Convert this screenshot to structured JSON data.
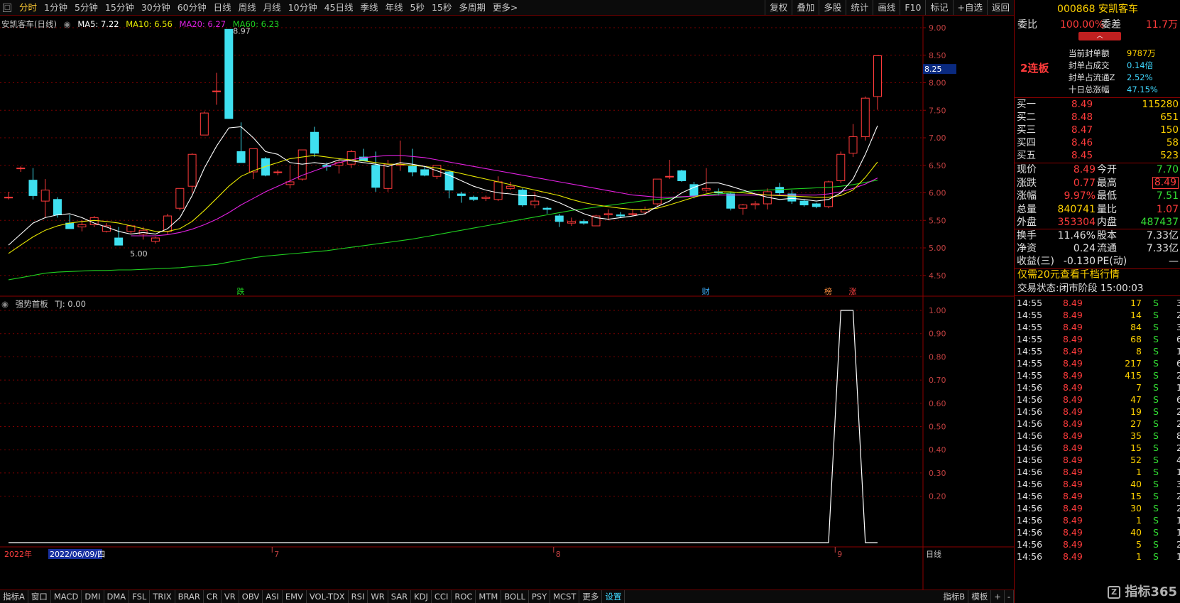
{
  "periods": [
    "分时",
    "1分钟",
    "5分钟",
    "15分钟",
    "30分钟",
    "60分钟",
    "日线",
    "周线",
    "月线",
    "10分钟",
    "45日线",
    "季线",
    "年线",
    "5秒",
    "15秒",
    "多周期",
    "更多>"
  ],
  "tools": [
    "复权",
    "叠加",
    "多股",
    "统计",
    "画线",
    "F10",
    "标记",
    "+自选",
    "返回"
  ],
  "legend": {
    "name": "安凯客车(日线)",
    "ma5": "MA5: 7.22",
    "ma10": "MA10: 6.56",
    "ma20": "MA20: 6.27",
    "ma60": "MA60: 6.23"
  },
  "colors": {
    "up": "#ff3b3b",
    "down": "#3fe0f0",
    "ma5": "#ffffff",
    "ma10": "#e8e800",
    "ma20": "#e020e0",
    "ma60": "#20d020",
    "grid": "#7a0000"
  },
  "price_axis": [
    "9.00",
    "8.50",
    "8.00",
    "7.50",
    "7.00",
    "6.50",
    "6.00",
    "5.50",
    "5.00",
    "4.50"
  ],
  "current_price_label": "8.25",
  "high_label": "8.97",
  "low_label": "5.00",
  "markers": [
    "跌",
    "财",
    "榜",
    "涨"
  ],
  "indicator": {
    "title": "强势首板",
    "value": "TJ: 0.00",
    "axis": [
      "1.00",
      "0.90",
      "0.80",
      "0.70",
      "0.60",
      "0.50",
      "0.40",
      "0.30",
      "0.20"
    ]
  },
  "date_axis": {
    "year": "2022年",
    "cursor": "2022/06/09/四",
    "months": [
      "7",
      "8",
      "9"
    ],
    "cycle": "日线"
  },
  "bottom_tabs": [
    "指标A",
    "窗口",
    "MACD",
    "DMI",
    "DMA",
    "FSL",
    "TRIX",
    "BRAR",
    "CR",
    "VR",
    "OBV",
    "ASI",
    "EMV",
    "VOL-TDX",
    "RSI",
    "WR",
    "SAR",
    "KDJ",
    "CCI",
    "ROC",
    "MTM",
    "BOLL",
    "PSY",
    "MCST",
    "更多",
    "设置"
  ],
  "bottom_right": [
    "指标B",
    "模板",
    "+",
    "-"
  ],
  "stock": {
    "code": "000868",
    "name": "安凯客车"
  },
  "weibi": {
    "label": "委比",
    "value": "100.00%",
    "cha_label": "委差",
    "cha": "11.7万"
  },
  "limit": {
    "boards": "2连板",
    "rows": [
      [
        "当前封单额",
        "9787万"
      ],
      [
        "封单占成交",
        "0.14倍"
      ],
      [
        "封单占流通Z",
        "2.52%"
      ],
      [
        "十日总涨幅",
        "47.15%"
      ]
    ]
  },
  "bids": [
    [
      "买一",
      "8.49",
      "115280"
    ],
    [
      "买二",
      "8.48",
      "651"
    ],
    [
      "买三",
      "8.47",
      "150"
    ],
    [
      "买四",
      "8.46",
      "58"
    ],
    [
      "买五",
      "8.45",
      "523"
    ]
  ],
  "quote": [
    [
      "现价",
      "8.49",
      "今开",
      "7.70"
    ],
    [
      "涨跌",
      "0.77",
      "最高",
      "8.49"
    ],
    [
      "涨幅",
      "9.97%",
      "最低",
      "7.51"
    ],
    [
      "总量",
      "840741",
      "量比",
      "1.07"
    ],
    [
      "外盘",
      "353304",
      "内盘",
      "487437"
    ]
  ],
  "fin": [
    [
      "换手",
      "11.46%",
      "股本",
      "7.33亿"
    ],
    [
      "净资",
      "0.24",
      "流通",
      "7.33亿"
    ],
    [
      "收益(三)",
      "-0.130",
      "PE(动)",
      "—"
    ]
  ],
  "promo": "仅需20元查看千档行情",
  "status": {
    "label": "交易状态:",
    "value": "闭市阶段 15:00:03"
  },
  "ticks": [
    [
      "14:55",
      "8.49",
      "17",
      "S",
      "3"
    ],
    [
      "14:55",
      "8.49",
      "14",
      "S",
      "2"
    ],
    [
      "14:55",
      "8.49",
      "84",
      "S",
      "3"
    ],
    [
      "14:55",
      "8.49",
      "68",
      "S",
      "6"
    ],
    [
      "14:55",
      "8.49",
      "8",
      "S",
      "1"
    ],
    [
      "14:55",
      "8.49",
      "217",
      "S",
      "6"
    ],
    [
      "14:55",
      "8.49",
      "415",
      "S",
      "2"
    ],
    [
      "14:56",
      "8.49",
      "7",
      "S",
      "1"
    ],
    [
      "14:56",
      "8.49",
      "47",
      "S",
      "6"
    ],
    [
      "14:56",
      "8.49",
      "19",
      "S",
      "2"
    ],
    [
      "14:56",
      "8.49",
      "27",
      "S",
      "2"
    ],
    [
      "14:56",
      "8.49",
      "35",
      "S",
      "8"
    ],
    [
      "14:56",
      "8.49",
      "15",
      "S",
      "2"
    ],
    [
      "14:56",
      "8.49",
      "52",
      "S",
      "4"
    ],
    [
      "14:56",
      "8.49",
      "1",
      "S",
      "1"
    ],
    [
      "14:56",
      "8.49",
      "40",
      "S",
      "3"
    ],
    [
      "14:56",
      "8.49",
      "15",
      "S",
      "2"
    ],
    [
      "14:56",
      "8.49",
      "30",
      "S",
      "2"
    ],
    [
      "14:56",
      "8.49",
      "1",
      "S",
      "1"
    ],
    [
      "14:56",
      "8.49",
      "40",
      "S",
      "1"
    ],
    [
      "14:56",
      "8.49",
      "5",
      "S",
      "2"
    ],
    [
      "14:56",
      "8.49",
      "1",
      "S",
      "1"
    ]
  ],
  "watermark": "指标365",
  "candles": [
    [
      5.92,
      6.02,
      5.88,
      5.92
    ],
    [
      6.45,
      6.48,
      6.38,
      6.45
    ],
    [
      6.23,
      6.45,
      5.88,
      5.95
    ],
    [
      5.85,
      6.25,
      5.55,
      6.05
    ],
    [
      5.88,
      5.92,
      5.55,
      5.6
    ],
    [
      5.45,
      5.6,
      5.35,
      5.35
    ],
    [
      5.38,
      5.5,
      5.3,
      5.42
    ],
    [
      5.42,
      5.58,
      5.38,
      5.55
    ],
    [
      5.3,
      5.45,
      5.28,
      5.4
    ],
    [
      5.18,
      5.38,
      5.05,
      5.05
    ],
    [
      5.3,
      5.42,
      5.25,
      5.4
    ],
    [
      5.25,
      5.38,
      5.15,
      5.32
    ],
    [
      5.12,
      5.2,
      5.08,
      5.18
    ],
    [
      5.3,
      5.62,
      5.25,
      5.58
    ],
    [
      5.72,
      6.08,
      5.68,
      6.08
    ],
    [
      6.12,
      6.72,
      6.0,
      6.7
    ],
    [
      7.05,
      7.48,
      7.05,
      7.45
    ],
    [
      7.85,
      8.18,
      7.6,
      7.85
    ],
    [
      8.97,
      8.97,
      7.35,
      7.35
    ],
    [
      6.75,
      7.28,
      6.6,
      6.55
    ],
    [
      6.38,
      6.8,
      6.25,
      6.8
    ],
    [
      6.62,
      6.65,
      6.3,
      6.32
    ],
    [
      6.38,
      6.42,
      6.32,
      6.38
    ],
    [
      6.15,
      6.5,
      6.08,
      6.2
    ],
    [
      6.25,
      6.78,
      6.22,
      6.78
    ],
    [
      7.1,
      7.2,
      6.65,
      6.72
    ],
    [
      6.5,
      6.55,
      6.4,
      6.48
    ],
    [
      6.5,
      6.6,
      6.35,
      6.55
    ],
    [
      6.52,
      6.78,
      6.45,
      6.75
    ],
    [
      6.65,
      6.8,
      6.58,
      6.58
    ],
    [
      6.5,
      6.75,
      6.02,
      6.1
    ],
    [
      6.08,
      6.6,
      6.02,
      6.52
    ],
    [
      6.5,
      6.95,
      6.4,
      6.52
    ],
    [
      6.48,
      6.8,
      6.3,
      6.38
    ],
    [
      6.42,
      6.48,
      6.3,
      6.32
    ],
    [
      6.3,
      6.5,
      6.25,
      6.5
    ],
    [
      6.38,
      6.4,
      5.9,
      6.05
    ],
    [
      5.98,
      6.02,
      5.82,
      5.95
    ],
    [
      5.92,
      5.95,
      5.85,
      5.88
    ],
    [
      5.9,
      5.95,
      5.85,
      5.92
    ],
    [
      5.88,
      6.3,
      5.85,
      6.2
    ],
    [
      6.08,
      6.2,
      6.05,
      6.12
    ],
    [
      6.05,
      6.08,
      5.75,
      5.78
    ],
    [
      5.78,
      6.02,
      5.72,
      5.85
    ],
    [
      5.72,
      5.75,
      5.62,
      5.7
    ],
    [
      5.58,
      5.62,
      5.38,
      5.48
    ],
    [
      5.45,
      5.55,
      5.4,
      5.48
    ],
    [
      5.48,
      5.52,
      5.42,
      5.45
    ],
    [
      5.4,
      5.6,
      5.4,
      5.58
    ],
    [
      5.6,
      5.7,
      5.5,
      5.62
    ],
    [
      5.6,
      5.65,
      5.55,
      5.58
    ],
    [
      5.62,
      5.7,
      5.58,
      5.62
    ],
    [
      5.65,
      5.75,
      5.6,
      5.7
    ],
    [
      5.8,
      6.25,
      5.75,
      6.25
    ],
    [
      6.3,
      6.6,
      6.25,
      6.3
    ],
    [
      6.4,
      6.42,
      6.2,
      6.22
    ],
    [
      6.15,
      6.2,
      5.9,
      5.95
    ],
    [
      6.05,
      6.45,
      6.0,
      6.08
    ],
    [
      6.02,
      6.08,
      5.95,
      6.0
    ],
    [
      5.98,
      6.02,
      5.68,
      5.72
    ],
    [
      5.72,
      5.8,
      5.6,
      5.78
    ],
    [
      5.78,
      5.85,
      5.7,
      5.8
    ],
    [
      5.8,
      6.08,
      5.7,
      6.02
    ],
    [
      6.1,
      6.18,
      5.95,
      6.0
    ],
    [
      5.98,
      6.05,
      5.8,
      5.85
    ],
    [
      5.85,
      5.88,
      5.75,
      5.78
    ],
    [
      5.8,
      5.82,
      5.72,
      5.75
    ],
    [
      5.75,
      6.22,
      5.72,
      6.2
    ],
    [
      6.22,
      6.75,
      6.18,
      6.7
    ],
    [
      6.72,
      7.25,
      6.65,
      7.02
    ],
    [
      7.02,
      7.75,
      6.95,
      7.72
    ],
    [
      7.75,
      8.49,
      7.51,
      8.49
    ]
  ],
  "ma5": [
    5.05,
    5.25,
    5.45,
    5.55,
    5.6,
    5.62,
    5.55,
    5.45,
    5.38,
    5.3,
    5.25,
    5.28,
    5.25,
    5.35,
    5.55,
    5.95,
    6.45,
    6.85,
    7.18,
    7.2,
    7.0,
    6.75,
    6.7,
    6.55,
    6.52,
    6.55,
    6.52,
    6.6,
    6.58,
    6.55,
    6.52,
    6.48,
    6.55,
    6.52,
    6.48,
    6.4,
    6.32,
    6.22,
    6.12,
    6.05,
    6.0,
    5.98,
    5.95,
    5.95,
    5.9,
    5.82,
    5.72,
    5.62,
    5.55,
    5.52,
    5.55,
    5.58,
    5.62,
    5.75,
    5.85,
    6.0,
    6.1,
    6.18,
    6.18,
    6.12,
    6.05,
    5.98,
    5.92,
    5.88,
    5.9,
    5.88,
    5.85,
    5.88,
    6.0,
    6.25,
    6.7,
    7.22
  ],
  "ma10": [
    4.9,
    5.05,
    5.2,
    5.32,
    5.4,
    5.45,
    5.48,
    5.5,
    5.48,
    5.45,
    5.4,
    5.35,
    5.3,
    5.3,
    5.35,
    5.48,
    5.68,
    5.9,
    6.12,
    6.3,
    6.4,
    6.48,
    6.55,
    6.62,
    6.65,
    6.68,
    6.65,
    6.62,
    6.6,
    6.58,
    6.55,
    6.52,
    6.52,
    6.5,
    6.48,
    6.45,
    6.4,
    6.35,
    6.3,
    6.25,
    6.2,
    6.15,
    6.1,
    6.05,
    6.0,
    5.95,
    5.88,
    5.82,
    5.78,
    5.75,
    5.72,
    5.7,
    5.7,
    5.72,
    5.78,
    5.85,
    5.92,
    5.98,
    6.02,
    6.02,
    6.0,
    5.98,
    5.96,
    5.95,
    5.94,
    5.93,
    5.92,
    5.92,
    5.95,
    6.05,
    6.28,
    6.56
  ],
  "ma20": [
    null,
    null,
    null,
    null,
    null,
    null,
    null,
    null,
    null,
    null,
    5.22,
    5.22,
    5.22,
    5.24,
    5.28,
    5.34,
    5.42,
    5.52,
    5.64,
    5.78,
    5.9,
    6.02,
    6.12,
    6.22,
    6.32,
    6.4,
    6.48,
    6.55,
    6.6,
    6.64,
    6.66,
    6.68,
    6.68,
    6.66,
    6.64,
    6.6,
    6.56,
    6.52,
    6.48,
    6.44,
    6.4,
    6.36,
    6.32,
    6.28,
    6.24,
    6.2,
    6.16,
    6.12,
    6.08,
    6.04,
    6.0,
    5.96,
    5.94,
    5.92,
    5.92,
    5.93,
    5.94,
    5.95,
    5.96,
    5.96,
    5.96,
    5.96,
    5.96,
    5.96,
    5.96,
    5.96,
    5.96,
    5.98,
    6.02,
    6.08,
    6.16,
    6.27
  ],
  "ma60": [
    4.42,
    4.46,
    4.5,
    4.54,
    4.56,
    4.57,
    4.58,
    4.59,
    4.59,
    4.6,
    4.6,
    4.61,
    4.62,
    4.63,
    4.64,
    4.66,
    4.68,
    4.7,
    4.74,
    4.78,
    4.82,
    4.85,
    4.87,
    4.89,
    4.91,
    4.93,
    4.95,
    4.98,
    5.01,
    5.04,
    5.07,
    5.1,
    5.13,
    5.16,
    5.2,
    5.24,
    5.28,
    5.32,
    5.36,
    5.4,
    5.44,
    5.48,
    5.52,
    5.56,
    5.6,
    5.64,
    5.68,
    5.71,
    5.74,
    5.77,
    5.8,
    5.83,
    5.86,
    5.88,
    5.9,
    5.92,
    5.94,
    5.96,
    5.98,
    6.0,
    6.02,
    6.04,
    6.05,
    6.06,
    6.07,
    6.08,
    6.09,
    6.1,
    6.12,
    6.15,
    6.19,
    6.23
  ],
  "tj": [
    0,
    0,
    0,
    0,
    0,
    0,
    0,
    0,
    0,
    0,
    0,
    0,
    0,
    0,
    0,
    0,
    0,
    0,
    0,
    0,
    0,
    0,
    0,
    0,
    0,
    0,
    0,
    0,
    0,
    0,
    0,
    0,
    0,
    0,
    0,
    0,
    0,
    0,
    0,
    0,
    0,
    0,
    0,
    0,
    0,
    0,
    0,
    0,
    0,
    0,
    0,
    0,
    0,
    0,
    0,
    0,
    0,
    0,
    0,
    0,
    0,
    0,
    0,
    0,
    0,
    0,
    0,
    0,
    1,
    1,
    0,
    0
  ]
}
